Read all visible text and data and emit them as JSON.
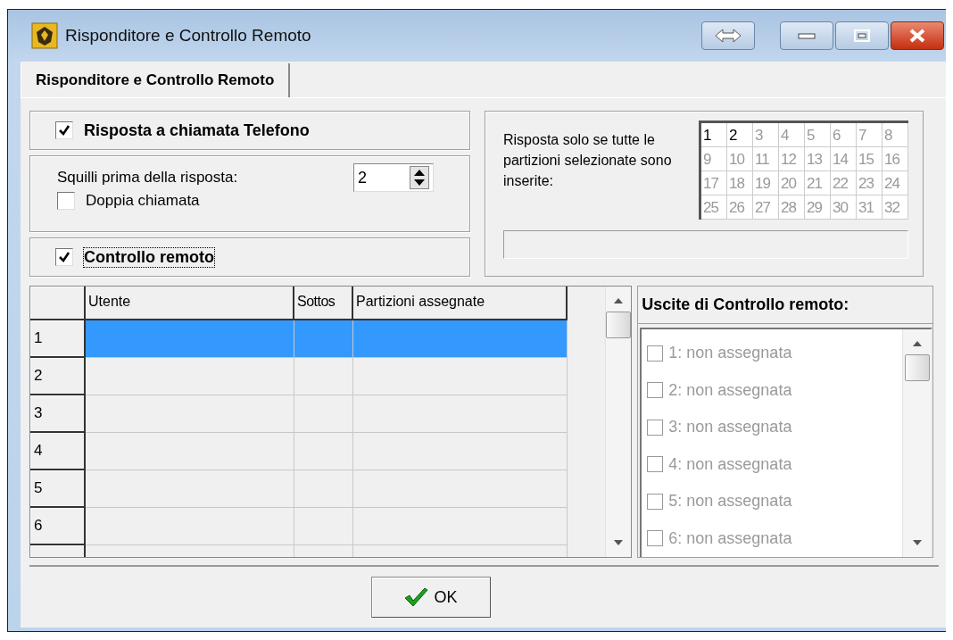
{
  "window": {
    "title": "Risponditore e Controllo Remoto"
  },
  "tabs": [
    {
      "label": "Risponditore e Controllo Remoto",
      "selected": true
    }
  ],
  "answer_call": {
    "label": "Risposta a chiamata Telefono",
    "checked": true
  },
  "rings": {
    "label": "Squilli prima della risposta:",
    "value": "2"
  },
  "double_call": {
    "label": "Doppia chiamata",
    "checked": false
  },
  "remote_control": {
    "label": "Controllo remoto",
    "checked": true
  },
  "partitions": {
    "label": "Risposta solo se tutte le partizioni selezionate sono inserite:",
    "cells": [
      {
        "label": "1",
        "selected": true
      },
      {
        "label": "2",
        "selected": true
      },
      {
        "label": "3",
        "selected": false
      },
      {
        "label": "4",
        "selected": false
      },
      {
        "label": "5",
        "selected": false
      },
      {
        "label": "6",
        "selected": false
      },
      {
        "label": "7",
        "selected": false
      },
      {
        "label": "8",
        "selected": false
      },
      {
        "label": "9",
        "selected": false
      },
      {
        "label": "10",
        "selected": false
      },
      {
        "label": "11",
        "selected": false
      },
      {
        "label": "12",
        "selected": false
      },
      {
        "label": "13",
        "selected": false
      },
      {
        "label": "14",
        "selected": false
      },
      {
        "label": "15",
        "selected": false
      },
      {
        "label": "16",
        "selected": false
      },
      {
        "label": "17",
        "selected": false
      },
      {
        "label": "18",
        "selected": false
      },
      {
        "label": "19",
        "selected": false
      },
      {
        "label": "20",
        "selected": false
      },
      {
        "label": "21",
        "selected": false
      },
      {
        "label": "22",
        "selected": false
      },
      {
        "label": "23",
        "selected": false
      },
      {
        "label": "24",
        "selected": false
      },
      {
        "label": "25",
        "selected": false
      },
      {
        "label": "26",
        "selected": false
      },
      {
        "label": "27",
        "selected": false
      },
      {
        "label": "28",
        "selected": false
      },
      {
        "label": "29",
        "selected": false
      },
      {
        "label": "30",
        "selected": false
      },
      {
        "label": "31",
        "selected": false
      },
      {
        "label": "32",
        "selected": false
      }
    ]
  },
  "table": {
    "columns": [
      "Utente",
      "Sottos",
      "Partizioni assegnate"
    ],
    "rows": [
      {
        "number": "1",
        "selected": true
      },
      {
        "number": "2",
        "selected": false
      },
      {
        "number": "3",
        "selected": false
      },
      {
        "number": "4",
        "selected": false
      },
      {
        "number": "5",
        "selected": false
      },
      {
        "number": "6",
        "selected": false
      }
    ]
  },
  "outputs": {
    "title": "Uscite di Controllo remoto:",
    "disabled": true,
    "items": [
      {
        "label": "1: non assegnata",
        "checked": false
      },
      {
        "label": "2: non assegnata",
        "checked": false
      },
      {
        "label": "3: non assegnata",
        "checked": false
      },
      {
        "label": "4: non assegnata",
        "checked": false
      },
      {
        "label": "5: non assegnata",
        "checked": false
      },
      {
        "label": "6: non assegnata",
        "checked": false
      }
    ]
  },
  "buttons": [
    {
      "label": "OK",
      "kind": "ok"
    }
  ]
}
